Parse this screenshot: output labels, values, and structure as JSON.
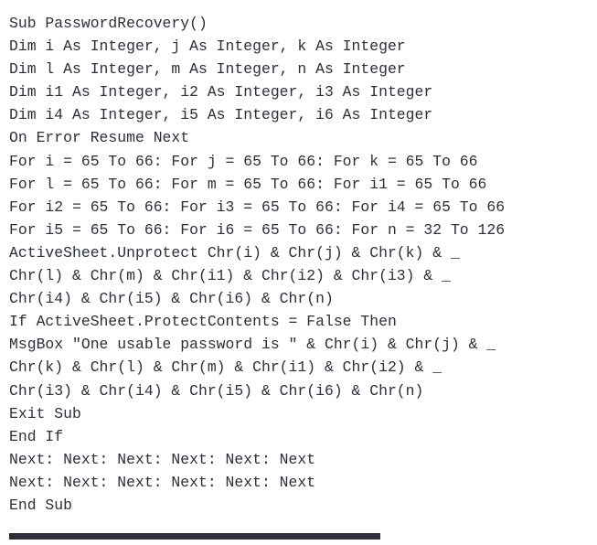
{
  "document": {
    "kind": "vba-code-snippet",
    "language": "VBA",
    "text_color": "#2c2e3c",
    "background_color": "#ffffff",
    "accent_bar_color": "#2e2e38",
    "code_lines": [
      "Sub PasswordRecovery()",
      "Dim i As Integer, j As Integer, k As Integer",
      "Dim l As Integer, m As Integer, n As Integer",
      "Dim i1 As Integer, i2 As Integer, i3 As Integer",
      "Dim i4 As Integer, i5 As Integer, i6 As Integer",
      "On Error Resume Next",
      "For i = 65 To 66: For j = 65 To 66: For k = 65 To 66",
      "For l = 65 To 66: For m = 65 To 66: For i1 = 65 To 66",
      "For i2 = 65 To 66: For i3 = 65 To 66: For i4 = 65 To 66",
      "For i5 = 65 To 66: For i6 = 65 To 66: For n = 32 To 126",
      "ActiveSheet.Unprotect Chr(i) & Chr(j) & Chr(k) & _",
      "Chr(l) & Chr(m) & Chr(i1) & Chr(i2) & Chr(i3) & _",
      "Chr(i4) & Chr(i5) & Chr(i6) & Chr(n)",
      "If ActiveSheet.ProtectContents = False Then",
      "MsgBox \"One usable password is \" & Chr(i) & Chr(j) & _",
      "Chr(k) & Chr(l) & Chr(m) & Chr(i1) & Chr(i2) & _",
      "Chr(i3) & Chr(i4) & Chr(i5) & Chr(i6) & Chr(n)",
      "Exit Sub",
      "End If",
      "Next: Next: Next: Next: Next: Next",
      "Next: Next: Next: Next: Next: Next",
      "End Sub"
    ]
  }
}
